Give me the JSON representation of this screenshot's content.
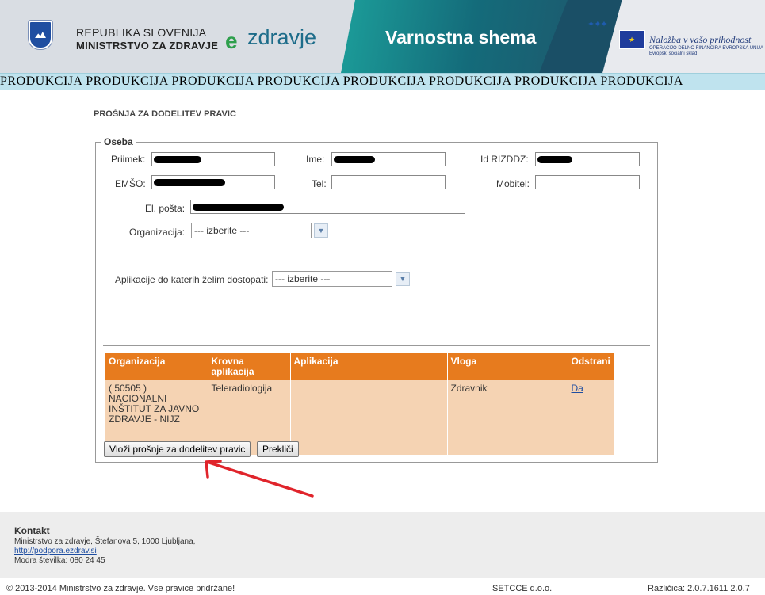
{
  "header": {
    "gov_line1": "REPUBLIKA SLOVENIJA",
    "gov_line2": "MINISTRSTVO ZA ZDRAVJE",
    "ezdravje_mark": "e",
    "ezdravje_text": "zdravje",
    "app_title": "Varnostna shema",
    "eu_slogan": "Naložba v vašo prihodnost",
    "eu_sub1": "OPERACIJO DELNO FINANCIRA EVROPSKA UNIJA",
    "eu_sub2": "Evropski socialni sklad"
  },
  "environment_banner": "PRODUKCIJA  PRODUKCIJA  PRODUKCIJA  PRODUKCIJA  PRODUKCIJA  PRODUKCIJA  PRODUKCIJA  PRODUKCIJA",
  "page_title": "PROŠNJA ZA DODELITEV PRAVIC",
  "form": {
    "legend": "Oseba",
    "labels": {
      "priimek": "Priimek:",
      "ime": "Ime:",
      "id_rizddz": "Id RIZDDZ:",
      "emso": "EMŠO:",
      "tel": "Tel:",
      "mobitel": "Mobitel:",
      "email": "El. pošta:",
      "organizacija": "Organizacija:",
      "aplikacije": "Aplikacije do katerih želim dostopati:"
    },
    "organizacija_selected": "--- izberite ---",
    "aplikacije_selected": "--- izberite ---"
  },
  "table": {
    "headers": [
      "Organizacija",
      "Krovna aplikacija",
      "Aplikacija",
      "Vloga",
      "Odstrani"
    ],
    "rows": [
      {
        "organizacija": "( 50505 ) NACIONALNI INŠTITUT ZA JAVNO ZDRAVJE - NIJZ",
        "krovna": "Teleradiologija",
        "aplikacija": "",
        "vloga": "Zdravnik",
        "odstrani": "Da"
      }
    ]
  },
  "buttons": {
    "submit": "Vloži prošnje za dodelitev pravic",
    "cancel": "Prekliči"
  },
  "footer": {
    "kontakt_title": "Kontakt",
    "address": "Ministrstvo za zdravje, Štefanova 5, 1000 Ljubljana,",
    "support_link": "http://podpora.ezdrav.si",
    "phone": "Modra številka: 080 24 45",
    "copyright": "© 2013-2014 Ministrstvo za zdravje. Vse pravice pridržane!",
    "vendor": "SETCCE d.o.o.",
    "version": "Različica: 2.0.7.1611 2.0.7"
  },
  "colors": {
    "table_header": "#e77b1e",
    "table_row": "#f5d3b3",
    "banner": "#bfe3ee",
    "annotation_arrow": "#e0242b"
  }
}
